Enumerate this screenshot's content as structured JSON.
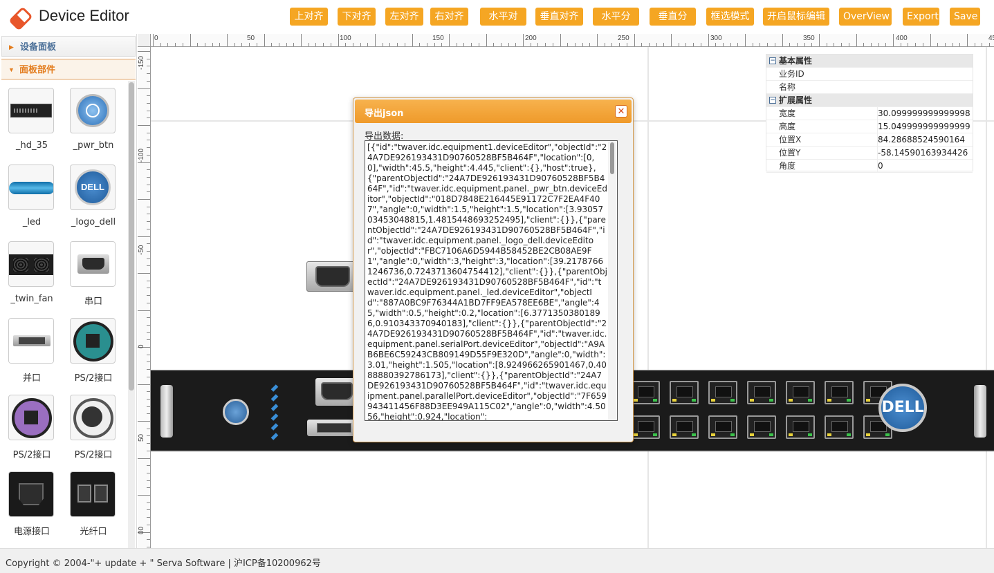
{
  "app": {
    "title": "Device Editor"
  },
  "toolbar": {
    "buttons": [
      "上对齐",
      "下对齐",
      "左对齐",
      "右对齐",
      "水平对齐",
      "垂直对齐",
      "水平分布",
      "垂直分布",
      "框选模式",
      "开启鼠标编辑",
      "OverView",
      "Export",
      "Save"
    ],
    "accent_color": "#f5a623"
  },
  "sidebar": {
    "sections": [
      {
        "label": "设备面板",
        "expanded": false
      },
      {
        "label": "面板部件",
        "expanded": true
      }
    ],
    "items": [
      {
        "label": "_hd_35",
        "icon": "hard-disk-icon"
      },
      {
        "label": "_pwr_btn",
        "icon": "power-button-icon"
      },
      {
        "label": "_led",
        "icon": "led-icon"
      },
      {
        "label": "_logo_dell",
        "icon": "dell-logo-icon"
      },
      {
        "label": "_twin_fan",
        "icon": "twin-fan-icon"
      },
      {
        "label": "串口",
        "icon": "serial-port-icon"
      },
      {
        "label": "并口",
        "icon": "parallel-port-icon"
      },
      {
        "label": "PS/2接口",
        "icon": "ps2-green-icon"
      },
      {
        "label": "PS/2接口",
        "icon": "ps2-purple-icon"
      },
      {
        "label": "PS/2接口",
        "icon": "ps2-white-icon"
      },
      {
        "label": "电源接口",
        "icon": "power-socket-icon"
      },
      {
        "label": "光纤口",
        "icon": "fiber-port-icon"
      }
    ]
  },
  "ruler": {
    "top_labels": [
      "0",
      "50",
      "100",
      "150",
      "200",
      "250",
      "300",
      "350",
      "400",
      "45"
    ],
    "left_labels": [
      "-150",
      "-100",
      "-50",
      "0",
      "50",
      "00"
    ]
  },
  "properties": {
    "categories": [
      {
        "label": "基本属性",
        "rows": [
          {
            "key": "业务ID",
            "value": ""
          },
          {
            "key": "名称",
            "value": ""
          }
        ]
      },
      {
        "label": "扩展属性",
        "rows": [
          {
            "key": "宽度",
            "value": "30.099999999999998"
          },
          {
            "key": "高度",
            "value": "15.049999999999999"
          },
          {
            "key": "位置X",
            "value": "84.28688524590164"
          },
          {
            "key": "位置Y",
            "value": "-58.14590163934426"
          },
          {
            "key": "角度",
            "value": "0"
          }
        ]
      }
    ]
  },
  "dialog": {
    "title": "导出json",
    "label": "导出数据:",
    "content": "[{\"id\":\"twaver.idc.equipment1.deviceEditor\",\"objectId\":\"24A7DE926193431D90760528BF5B464F\",\"location\":[0,0],\"width\":45.5,\"height\":4.445,\"client\":{},\"host\":true},{\"parentObjectId\":\"24A7DE926193431D90760528BF5B464F\",\"id\":\"twaver.idc.equipment.panel._pwr_btn.deviceEditor\",\"objectId\":\"018D7848E216445E91172C7F2EA4F407\",\"angle\":0,\"width\":1.5,\"height\":1.5,\"location\":[3.9305703453048815,1.4815448693252495],\"client\":{}},{\"parentObjectId\":\"24A7DE926193431D90760528BF5B464F\",\"id\":\"twaver.idc.equipment.panel._logo_dell.deviceEditor\",\"objectId\":\"FBC7106A6D5944B58452BE2CB08AE9F1\",\"angle\":0,\"width\":3,\"height\":3,\"location\":[39.21787661246736,0.7243713604754412],\"client\":{}},{\"parentObjectId\":\"24A7DE926193431D90760528BF5B464F\",\"id\":\"twaver.idc.equipment.panel._led.deviceEditor\",\"objectId\":\"887A0BC9F76344A1BD7FF9EA578EE6BE\",\"angle\":45,\"width\":0.5,\"height\":0.2,\"location\":[6.37713503801896,0.910343370940183],\"client\":{}},{\"parentObjectId\":\"24A7DE926193431D90760528BF5B464F\",\"id\":\"twaver.idc.equipment.panel.serialPort.deviceEditor\",\"objectId\":\"A9AB6BE6C59243CB809149D55F9E320D\",\"angle\":0,\"width\":3.01,\"height\":1.505,\"location\":[8.924966265901467,0.4088880392786173],\"client\":{}},{\"parentObjectId\":\"24A7DE926193431D90760528BF5B464F\",\"id\":\"twaver.idc.equipment.panel.parallelPort.deviceEditor\",\"objectId\":\"7F659943411456F88D3EE949A115C02\",\"angle\":0,\"width\":4.5056,\"height\":0.924,\"location\":"
  },
  "footer": {
    "text": "Copyright © 2004-\"+ update + \" Serva Software | 沪ICP备10200962号"
  }
}
